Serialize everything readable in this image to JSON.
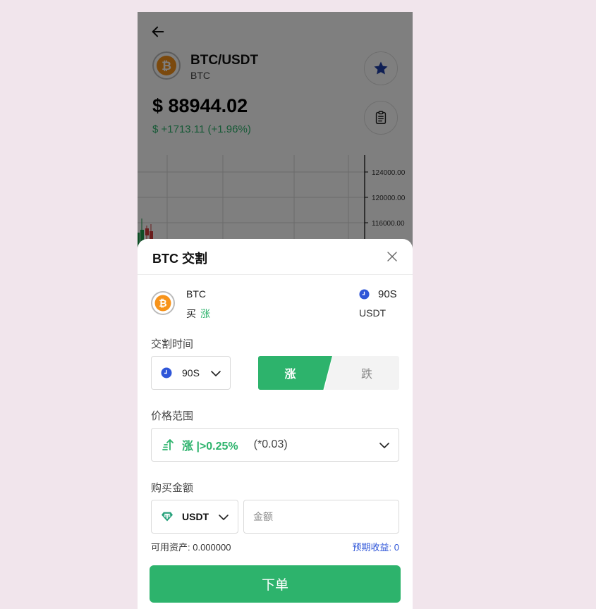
{
  "header": {
    "pair": "BTC/USDT",
    "coin": "BTC",
    "price": "$ 88944.02",
    "change": "$ +1713.11 (+1.96%)"
  },
  "chart": {
    "y_ticks": [
      "124000.00",
      "120000.00",
      "116000.00"
    ]
  },
  "sheet": {
    "title": "BTC 交割",
    "summary": {
      "coin": "BTC",
      "buy_label": "买",
      "direction": "涨",
      "duration": "90S",
      "currency": "USDT"
    },
    "delivery_time_label": "交割时间",
    "delivery_time_value": "90S",
    "toggle": {
      "up": "涨",
      "down": "跌"
    },
    "price_range_label": "价格范围",
    "price_range_value": "涨 |>0.25%",
    "price_range_multiplier": "(*0.03)",
    "amount_label": "购买金额",
    "currency_value": "USDT",
    "amount_placeholder": "金额",
    "available": "可用资产: 0.000000",
    "expected": "预期收益: 0",
    "order_button": "下单"
  },
  "colors": {
    "green": "#2db36c",
    "blue_link": "#2f56d8",
    "clock_blue": "#2f56d8",
    "star_blue": "#1f3fa8",
    "btc_orange": "#f7931a"
  }
}
